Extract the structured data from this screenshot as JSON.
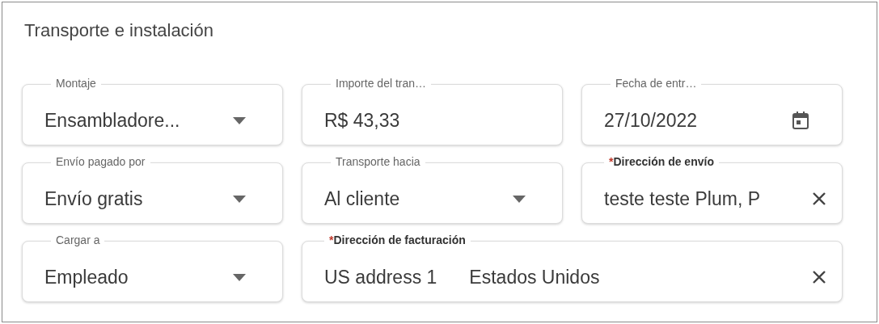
{
  "section": {
    "title": "Transporte e instalación"
  },
  "fields": [
    {
      "kind": "select",
      "label": "Montaje",
      "required": false,
      "wide": false,
      "values": [
        "Ensambladore..."
      ]
    },
    {
      "kind": "text",
      "label": "Importe del tran…",
      "required": false,
      "wide": false,
      "values": [
        "R$ 43,33"
      ]
    },
    {
      "kind": "date",
      "label": "Fecha de entr…",
      "required": false,
      "wide": false,
      "values": [
        "27/10/2022"
      ]
    },
    {
      "kind": "select",
      "label": "Envío pagado por",
      "required": false,
      "wide": false,
      "values": [
        "Envío gratis"
      ]
    },
    {
      "kind": "select",
      "label": "Transporte hacia",
      "required": false,
      "wide": false,
      "values": [
        "Al cliente"
      ]
    },
    {
      "kind": "clearable",
      "label": "Dirección de envío",
      "required": true,
      "mark": "*",
      "wide": false,
      "values": [
        "teste teste Plum, P"
      ]
    },
    {
      "kind": "select",
      "label": "Cargar a",
      "required": false,
      "wide": false,
      "values": [
        "Empleado"
      ]
    },
    {
      "kind": "clearable",
      "label": "Dirección de facturación",
      "required": true,
      "mark": "*",
      "wide": true,
      "values": [
        "US address 1",
        "Estados Unidos"
      ]
    }
  ]
}
